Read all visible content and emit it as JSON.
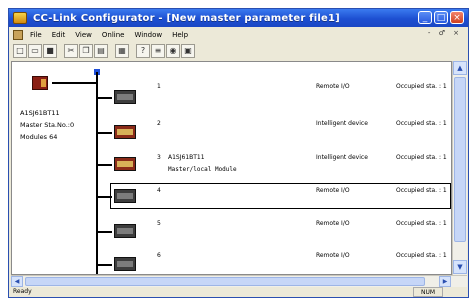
{
  "window": {
    "title": "CC-Link Configurator - [New master parameter file1]",
    "buttons": [
      "_",
      "□",
      "×"
    ]
  },
  "menu": {
    "items": [
      "File",
      "Edit",
      "View",
      "Online",
      "Window",
      "Help"
    ],
    "mdi_controls": "- ♂ ×"
  },
  "toolbar": {
    "icons": [
      "new-icon",
      "open-icon",
      "save-icon",
      "cut-icon",
      "copy-icon",
      "paste-icon",
      "print-icon",
      "help-icon",
      "list-icon",
      "monitor-icon",
      "module-icon"
    ]
  },
  "master": {
    "model": "A1SJ61BT11",
    "station": "Master  Sta.No.:0",
    "modules": "Modules      64"
  },
  "stations": [
    {
      "no": "1",
      "name": "",
      "subname": "",
      "type": "Remote I/O",
      "occupied": "Occupied sta. :  1"
    },
    {
      "no": "2",
      "name": "",
      "subname": "",
      "type": "Intelligent device",
      "occupied": "Occupied sta. :  1"
    },
    {
      "no": "3",
      "name": "A1SJ61BT11",
      "subname": "Master/local Module",
      "type": "Intelligent device",
      "occupied": "Occupied sta. :  1"
    },
    {
      "no": "4",
      "name": "",
      "subname": "",
      "type": "Remote I/O",
      "occupied": "Occupied sta. :  1"
    },
    {
      "no": "5",
      "name": "",
      "subname": "",
      "type": "Remote I/O",
      "occupied": "Occupied sta. :  1"
    },
    {
      "no": "6",
      "name": "",
      "subname": "",
      "type": "Remote I/O",
      "occupied": "Occupied sta. :  1"
    }
  ],
  "status": {
    "text": "Ready",
    "num": "NUM"
  }
}
